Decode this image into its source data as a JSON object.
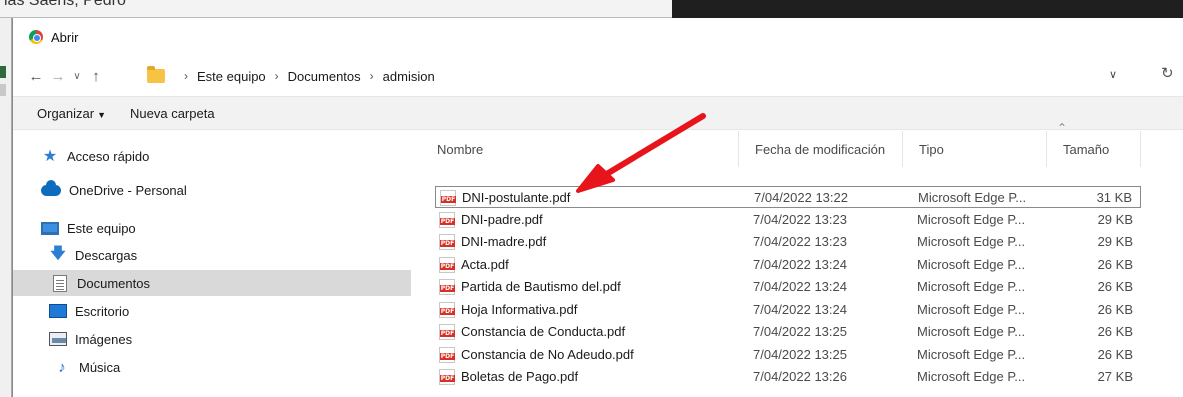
{
  "window": {
    "title": "Abrir"
  },
  "background": {
    "partial_title": "ias Saens, Pedro"
  },
  "nav": {
    "back_icon": "back-arrow-icon",
    "forward_icon": "forward-arrow-icon",
    "recent_icon": "chevron-down-icon",
    "up_icon": "up-arrow-icon"
  },
  "address": {
    "breadcrumbs": [
      "Este equipo",
      "Documentos",
      "admision"
    ]
  },
  "toolbar": {
    "organize_label": "Organizar",
    "new_folder_label": "Nueva carpeta"
  },
  "sidebar": {
    "items": [
      {
        "label": "Acceso rápido",
        "icon": "star-icon"
      },
      {
        "label": "OneDrive - Personal",
        "icon": "cloud-icon"
      },
      {
        "label": "Este equipo",
        "icon": "computer-icon"
      },
      {
        "label": "Descargas",
        "icon": "download-icon"
      },
      {
        "label": "Documentos",
        "icon": "document-icon",
        "selected": true
      },
      {
        "label": "Escritorio",
        "icon": "desktop-icon"
      },
      {
        "label": "Imágenes",
        "icon": "image-icon"
      },
      {
        "label": "Música",
        "icon": "music-icon"
      }
    ]
  },
  "columns": {
    "name": "Nombre",
    "date": "Fecha de modificación",
    "type": "Tipo",
    "size": "Tamaño"
  },
  "files": [
    {
      "name": "DNI-postulante.pdf",
      "date": "7/04/2022 13:22",
      "type": "Microsoft Edge P...",
      "size": "31 KB"
    },
    {
      "name": "DNI-padre.pdf",
      "date": "7/04/2022 13:23",
      "type": "Microsoft Edge P...",
      "size": "29 KB"
    },
    {
      "name": "DNI-madre.pdf",
      "date": "7/04/2022 13:23",
      "type": "Microsoft Edge P...",
      "size": "29 KB"
    },
    {
      "name": "Acta.pdf",
      "date": "7/04/2022 13:24",
      "type": "Microsoft Edge P...",
      "size": "26 KB"
    },
    {
      "name": "Partida de Bautismo del.pdf",
      "date": "7/04/2022 13:24",
      "type": "Microsoft Edge P...",
      "size": "26 KB"
    },
    {
      "name": "Hoja Informativa.pdf",
      "date": "7/04/2022 13:24",
      "type": "Microsoft Edge P...",
      "size": "26 KB"
    },
    {
      "name": "Constancia de Conducta.pdf",
      "date": "7/04/2022 13:25",
      "type": "Microsoft Edge P...",
      "size": "26 KB"
    },
    {
      "name": "Constancia de No Adeudo.pdf",
      "date": "7/04/2022 13:25",
      "type": "Microsoft Edge P...",
      "size": "26 KB"
    },
    {
      "name": "Boletas de Pago.pdf",
      "date": "7/04/2022 13:26",
      "type": "Microsoft Edge P...",
      "size": "27 KB"
    }
  ],
  "file_icon_text": "PDF",
  "colors": {
    "annotation_arrow": "#e8141b",
    "selected_nav": "#d9d9d9"
  }
}
